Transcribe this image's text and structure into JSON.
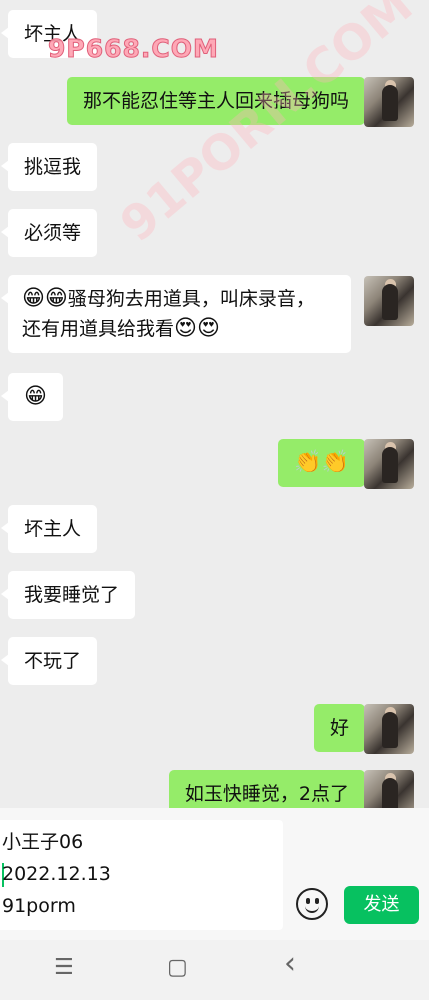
{
  "watermarks": [
    "9P668.COM",
    "91PORN.COM"
  ],
  "messages": [
    {
      "side": "in",
      "text": "坏主人"
    },
    {
      "side": "out",
      "text": "那不能忍住等主人回来插母狗吗"
    },
    {
      "side": "in",
      "text": "挑逗我"
    },
    {
      "side": "in",
      "text": "必须等"
    },
    {
      "side": "in",
      "line1_prefix": "😁😁",
      "line1": "骚母狗去用道具，叫床录音，",
      "line2": "还有用道具给我看",
      "line2_suffix": "😍😍"
    },
    {
      "side": "in",
      "text": "😁"
    },
    {
      "side": "out",
      "text": "👏👏"
    },
    {
      "side": "in",
      "text": "坏主人"
    },
    {
      "side": "in",
      "text": "我要睡觉了"
    },
    {
      "side": "in",
      "text": "不玩了"
    },
    {
      "side": "out",
      "text": "好"
    },
    {
      "side": "out",
      "text": "如玉快睡觉，2点了"
    }
  ],
  "input": {
    "lines": [
      "小王子06",
      "2022.12.13",
      "91porm"
    ]
  },
  "send_label": "发送",
  "icons": {
    "emoji": "smiley-icon",
    "nav": [
      "menu-icon",
      "home-square-icon",
      "back-chevron-icon"
    ]
  },
  "nav_glyphs": {
    "menu": "☰",
    "home": "▢",
    "back": "‹"
  },
  "colors": {
    "incoming": "#ffffff",
    "outgoing": "#95ec69",
    "send": "#07c160",
    "background": "#ededed"
  }
}
